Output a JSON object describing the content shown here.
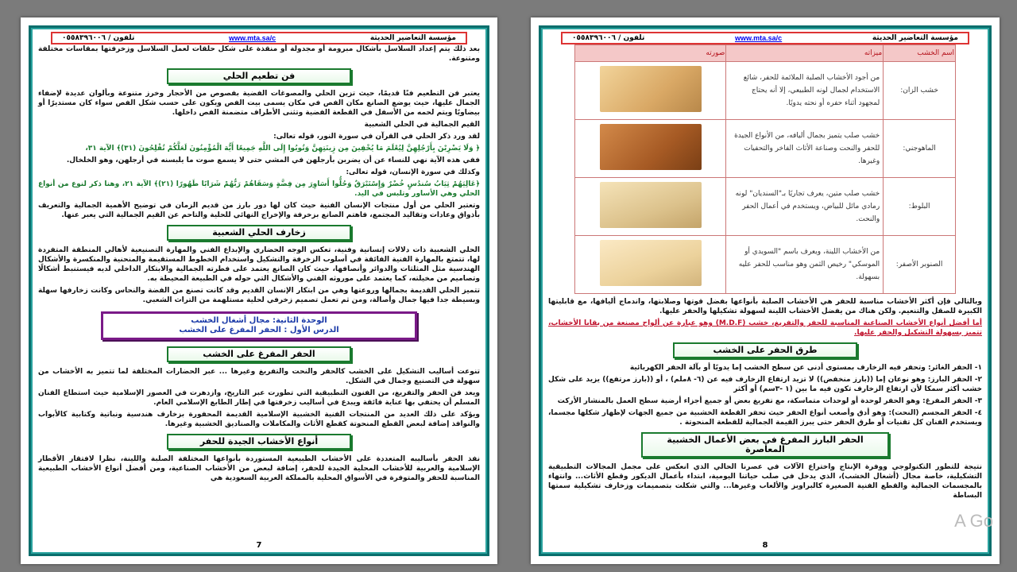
{
  "header": {
    "org": "مؤسسة التعاضير الحديثة",
    "url": "www.mta.sa/c",
    "phone": "تلفون / ٠٥٥٨٣٩٦٠٠٦"
  },
  "left_page": {
    "page_number": "7",
    "intro": "بعد ذلك يتم إعداد السلاسل بأشكال مبرومة أو مجدولة أو منقذة على شكل حلقات لعمل السلاسل وزخرفتها بمقاسات مختلفة ومتنوعة.",
    "h1": "فن تطعيم الحلي",
    "p1": "يعتبر فن التطعيم فنًا قديمًا، حيث تزين الحلي والمصوغات الفضية بفصوص من الأحجار وخرز متنوعة وبألوان عديدة لإضفاء الجمال عليها، حيث يوضع الصانع مكان الفص في مكان يسمى بيت الفص ويكون على حسب شكل الفص سواء كان مستديرًا أو بيضاويًا ويتم لحمه من الأسفل في القطعة الفضية وتثنى الأطراف متضمنة الفص داخلها.",
    "p2": "القيم الجمالية في الحلي الشعبية",
    "p3": "لقد ورد ذكر الحلي في القرآن في سورة النور، قوله تعالى:",
    "verse1": "﴿ وَلَا يَضْرِبْنَ بِأَرْجُلِهِنَّ لِيُعْلَمَ مَا يُخْفِينَ مِن زِينَتِهِنَّ وَتُوبُوا إِلَى اللَّهِ جَمِيعًا أَيُّهَ الْمُؤْمِنُونَ لَعَلَّكُمْ تُفْلِحُونَ (٣١)﴾ الآية ٣١،",
    "p4": "ففي هذه الآية نهي للنساء عن أن يضربن بأرجلهن في المشي حتى لا يسمع صوت ما يلبسنه في أرجلهن، وهو الخلخال.",
    "p5": "وكذلك في سورة الإنسان، قوله تعالى:",
    "verse2": "﴿عَالِيَهُمْ ثِيَابُ سُندُسٍ خُضْرٌ وَإِسْتَبْرَقٌ وَحُلُّوا أَسَاوِرَ مِن فِضَّةٍ وَسَقَاهُمْ رَبُّهُمْ شَرَابًا طَهُورًا (٢١)﴾ الآية ٢١، وهنا ذكر لنوع من أنواع الحلي وهي الأساور وتلبس في اليد.",
    "p6": "وتعتبر الحلي من أول منتجات الإنسان الفنية حيث كان لها دور بارز من قديم الزمان في توضيح الأهمية الجمالية والتعريف بأذواق وعادات وتقاليد المجتمع، فاهتم الصانع بزخرفة والإخراج النهائي للحلية والتاحم عن القيم الجمالية التي يعبر عنها.",
    "h2": "زخارف الحلي الشعبية",
    "p7": "الحلي الشعبية ذات دلالات إنسانية وفنية، تعكس الوجه الحضاري والإبداع الفني والمهارة التصنيعية لأهالي المنطقة المتفردة لها، تتمتع بالمهارة الفنية الفائقة في أسلوب الزخرفة والتشكيل واستخدام الخطوط المستقيمة والمنحنية والمنكسرة والأشكال الهندسية مثل المثلثات والدوائر وأنصافها، حيث كان الصانع يعتمد على فطرته الجمالية والابتكار الداخلي لديه فيستنبط أشكالًا وتصاميم من مخيلته، كما يعتمد على موروثه الفني والأشكال التي حوله في الطبيعة المحيطة به.",
    "p8": "تتميز الحلي القديمة بجمالها وروعتها وهي من ابتكار الإنسان القديم وقد كانت تصنع من الفضة والنحاس وكانت زخارفها سهلة وبسيطة جدا فيها جمال وأصالة، ومن ثم تعمل تصميم زخرفي لحلية مستلهمة من التراث الشعبي.",
    "unit_title": "الوحدة الثانية: مجال أشغال الخشب",
    "lesson_title": "الدرس الأول : الحفر المفرغ على الخشب",
    "h3": "الحفر المفرغ على الخشب",
    "p9": "تنوعت أساليب التشكيل على الخشب كالحفر والنحت والتفريغ وغيرها ... عبر الحضارات المختلفة لما تتميز به الأخشاب من سهولة في التصنيع وجمال في الشكل.",
    "p10": "ويعد فن الحفر والتفريغ، من الفنون التطبيقية التي تطورت عبر التاريخ، وازدهرت في العصور الإسلامية حيث استطاع الفنان المسلم أن يحتفي بها عناية فائقة ويبدع في أساليب زخرفتها في إطار الطابع الإسلامي العام.",
    "p11": "ويؤكد على ذلك العديد من المنتجات الفنية الخشبية الإسلامية القديمة المحفورة بزخارف هندسية ونباتية وكتابية كالأبواب والنوافذ إضافة لبعض القطع المنحوتة كقطع الأثاث والمكاملات والصناديق الخشبية وغيرها.",
    "h4": "أنواع الأخشاب الجيدة للحفر",
    "p12": "نفذ الحفر بأساليبه المتعددة على الأخشاب الطبيعية المستوردة بأنواعها المختلفة الصلبة واللينة، نظرا لافتقار الأقطار الإسلامية والعربية للأخشاب المحلية الجيدة للحفر، إضافة لبعض من الأخشاب الصناعية، ومن أفضل أنواع الأخشاب الطبيعية المناسبة للحفر والمتوفرة في الأسواق المحلية بالمملكة العربية السعودية هي"
  },
  "right_page": {
    "page_number": "8",
    "table": {
      "headers": [
        "اسم الخشب",
        "ميزاته",
        "صورته"
      ],
      "rows": [
        {
          "name": "خشب الزان:",
          "feature": "من أجود الأخشاب الصلبة الملائمة للحفر، شائع الاستخدام لجمال لونه الطبيعي، إلا أنه يحتاج لمجهود أثناء حفره أو نحته يدويًا.",
          "wood": "beech"
        },
        {
          "name": "الماهوجني:",
          "feature": "خشب صلب يتميز بجمال أليافه، من الأنواع الجيدة للحفر والنحت وصناعة الأثاث الفاخر والتحفيات وغيرها.",
          "wood": "mahogany"
        },
        {
          "name": "البلوط:",
          "feature": "خشب صلب متين، يعرف تجاريًا بـ\"السنديان\" لونه رمادي مائل للبياض، ويستخدم في أعمال الحفر والنحت.",
          "wood": "oak"
        },
        {
          "name": "الصنوبر الأصفر:",
          "feature": "من الأخشاب اللينة، ويعرف باسم \"السويدي أو الموسكي\" رخيص الثمن وهو مناسب للحفر عليه بسهولة.",
          "wood": "pine"
        }
      ]
    },
    "p1": "وبالتالي فإن أكثر الأخشاب مناسبة للحفر هي الأخشاب الصلبة بأنواعها بفضل قوتها وصلابتها، واندماج أليافها، مع قابليتها الكبيرة للصقل والتنعيم. ولكن هناك من يفضل الأخشاب اللينة لسهولة تشكيلها والحفر عليها.",
    "p2": "أما أفضل أنواع الأخشاب الصناعية المناسبة للحفر والتفريغ، خشب (M.D.F) وهو عبارة عن ألواح مصنعة من بقايا الأخشاب، تتميز بسهولة التشكيل والحفر عليها.",
    "h1": "طرق الحفر على الخشب",
    "m1": "١- الحفر الغائر: وتحفر فيه الزخارف بمستوى أدنى عن سطح الخشب إما يدويًا أو بآلة الحفر الكهربائية",
    "m2": "٢- الحفر البارز: وهو نوعان إما ((بارز منخفض)) لا تزيد ارتفاع الزخارف فيه عن (٦- ٨ملم) ، أو ((بارز مرتفع)) يزيد على شكل خشب أكثر سمكا لأن ارتفاع الزخارف تكون فيه ما بين (١ -٣سم) أو أكثر",
    "m3": "٣- الحفر المفرغ: وهو الحفر لوحدة أو لوحدات متماسكة، مع تفريغ بعض أو جميع أجزاء أرضية سطح العمل بالمنشار الأركت",
    "m4": "٤- الحفر المجسم (النحت): وهو أدق وأصعب أنواع الحفر حيث تحفر القطعة الخشبية من جميع الجهات لإظهار شكلها مجسما، ويستخدم الفنان كل تقنيات أو طرق الحفر حتى يبرز القيمة الجمالية للقطعة المنحوتة .",
    "h2": "الحفر البارز المفرغ في بعض الأعمال الخشبية المعاصرة",
    "p3": "نتيجة للتطور التكنولوجي ووفرة الإنتاج واختراع الآلات في عصرنا الحالي الذي انعكس على مجمل المجالات التطبيقية التشكيلية، خاصة مجال (أشغال الخشب)، الذي يدخل في صلب حياتنا اليومية، ابتداء بأعمال الديكور وقطع الأثاث... وانتهاء بالمجسمات الجمالية والقطع الفنية الصغيرة كالبراويز والألعاب وغيرها... والتي شكلت بتصميمات وزخارف تشكيلية سمتها البساطة"
  },
  "watermark": "A\nGo"
}
